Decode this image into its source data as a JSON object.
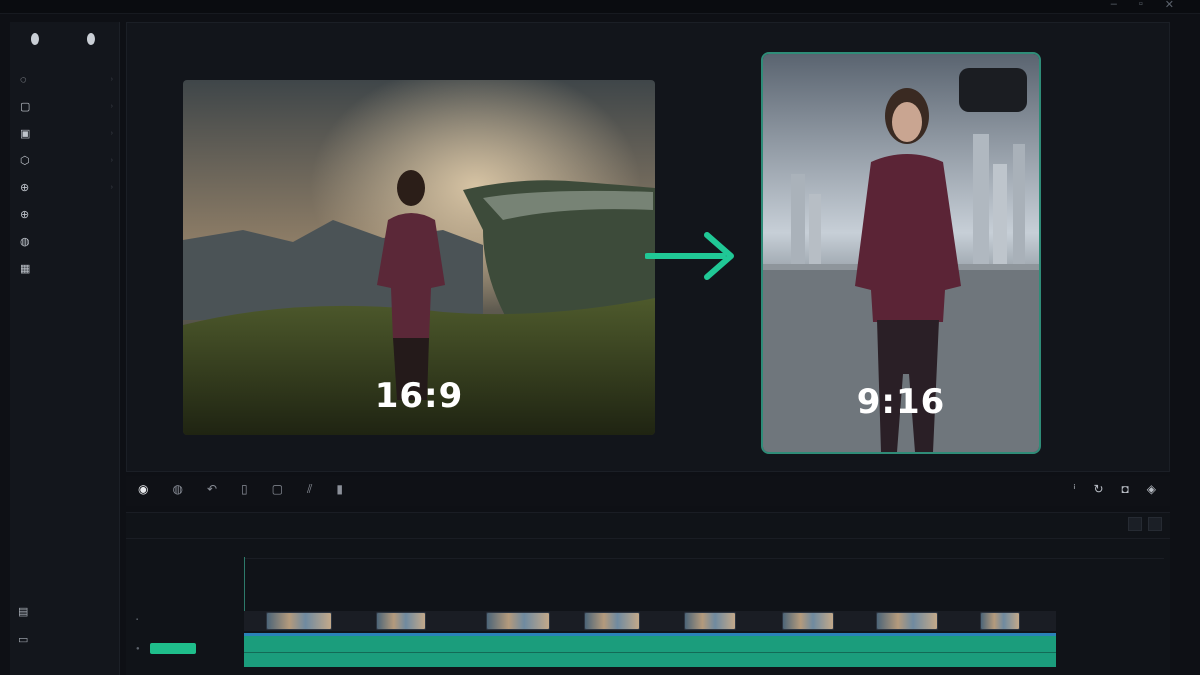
{
  "top": {
    "menu": [
      "",
      "",
      "",
      ""
    ]
  },
  "sidebar": {
    "tools": [
      {
        "icon": "droplet-icon",
        "label": ""
      },
      {
        "icon": "droplet-icon",
        "label": ""
      }
    ],
    "items": [
      {
        "icon": "circle-icon",
        "label": "",
        "has_chevron": true
      },
      {
        "icon": "square-icon",
        "label": "",
        "has_chevron": true
      },
      {
        "icon": "square-icon",
        "label": "",
        "has_chevron": true
      },
      {
        "icon": "lock-icon",
        "label": "",
        "has_chevron": true
      },
      {
        "icon": "plus-icon",
        "label": "",
        "has_chevron": true
      },
      {
        "icon": "plus-icon",
        "label": "",
        "has_chevron": false
      },
      {
        "icon": "circle-icon",
        "label": "",
        "has_chevron": false
      },
      {
        "icon": "grid-icon",
        "label": "",
        "has_chevron": false
      }
    ],
    "bottom": [
      {
        "icon": "media-icon",
        "label": ""
      },
      {
        "icon": "media-icon",
        "label": ""
      }
    ]
  },
  "preview": {
    "left_ratio": "16:9",
    "right_ratio": "9:16",
    "left_timestamp": "",
    "right_badge": "",
    "arrow_color": "#20c896",
    "frame_accent": "#2f8c78"
  },
  "toolbar": {
    "left_icons": [
      "eye-icon",
      "view-icon",
      "undo-icon",
      "copy-icon",
      "crop-icon",
      "split-icon",
      "delete-icon"
    ],
    "right_icons": [
      "info-icon",
      "redo-icon",
      "camera-icon",
      "settings-icon"
    ]
  },
  "timeline": {
    "tabs": [
      "",
      "",
      ""
    ],
    "center_label": "",
    "track_video_label": "",
    "track_audio_label": "",
    "clip_count": 8,
    "audio_color": "#1b9d7c"
  }
}
